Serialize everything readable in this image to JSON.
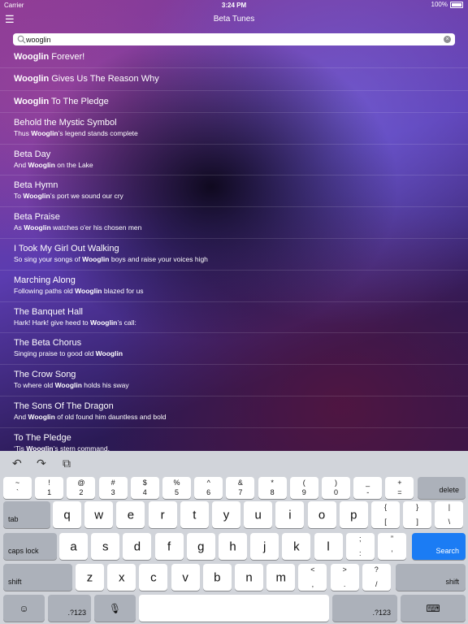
{
  "status": {
    "carrier": "Carrier",
    "time": "3:24 PM",
    "battery": "100%"
  },
  "nav": {
    "title": "Beta Tunes",
    "menu_icon": "hamburger-icon"
  },
  "search": {
    "value": "wooglin"
  },
  "results": [
    {
      "title": [
        {
          "t": "Wooglin",
          "b": true
        },
        {
          "t": " Forever!",
          "b": false
        }
      ],
      "subtitle": []
    },
    {
      "title": [
        {
          "t": "Wooglin",
          "b": true
        },
        {
          "t": " Gives Us The Reason Why",
          "b": false
        }
      ],
      "subtitle": []
    },
    {
      "title": [
        {
          "t": "Wooglin",
          "b": true
        },
        {
          "t": " To The Pledge",
          "b": false
        }
      ],
      "subtitle": []
    },
    {
      "title": [
        {
          "t": "Behold the Mystic Symbol",
          "b": false
        }
      ],
      "subtitle": [
        {
          "t": "Thus ",
          "b": false
        },
        {
          "t": "Wooglin",
          "b": true
        },
        {
          "t": "’s legend stands complete",
          "b": false
        }
      ]
    },
    {
      "title": [
        {
          "t": "Beta Day",
          "b": false
        }
      ],
      "subtitle": [
        {
          "t": "And ",
          "b": false
        },
        {
          "t": "Wooglin",
          "b": true
        },
        {
          "t": " on the Lake",
          "b": false
        }
      ]
    },
    {
      "title": [
        {
          "t": "Beta Hymn",
          "b": false
        }
      ],
      "subtitle": [
        {
          "t": "To ",
          "b": false
        },
        {
          "t": "Wooglin",
          "b": true
        },
        {
          "t": "’s port we sound our cry",
          "b": false
        }
      ]
    },
    {
      "title": [
        {
          "t": "Beta Praise",
          "b": false
        }
      ],
      "subtitle": [
        {
          "t": "As ",
          "b": false
        },
        {
          "t": "Wooglin",
          "b": true
        },
        {
          "t": " watches o'er his chosen men",
          "b": false
        }
      ]
    },
    {
      "title": [
        {
          "t": "I Took My Girl Out Walking",
          "b": false
        }
      ],
      "subtitle": [
        {
          "t": "So sing your songs of ",
          "b": false
        },
        {
          "t": "Wooglin",
          "b": true
        },
        {
          "t": " boys and raise your voices high",
          "b": false
        }
      ]
    },
    {
      "title": [
        {
          "t": "Marching Along",
          "b": false
        }
      ],
      "subtitle": [
        {
          "t": "Following paths old ",
          "b": false
        },
        {
          "t": "Wooglin",
          "b": true
        },
        {
          "t": " blazed for us",
          "b": false
        }
      ]
    },
    {
      "title": [
        {
          "t": "The Banquet Hall",
          "b": false
        }
      ],
      "subtitle": [
        {
          "t": "Hark! Hark! give heed to ",
          "b": false
        },
        {
          "t": "Wooglin",
          "b": true
        },
        {
          "t": "’s call:",
          "b": false
        }
      ]
    },
    {
      "title": [
        {
          "t": "The Beta Chorus",
          "b": false
        }
      ],
      "subtitle": [
        {
          "t": "Singing praise to good old ",
          "b": false
        },
        {
          "t": "Wooglin",
          "b": true
        }
      ]
    },
    {
      "title": [
        {
          "t": "The Crow Song",
          "b": false
        }
      ],
      "subtitle": [
        {
          "t": "To where old ",
          "b": false
        },
        {
          "t": "Wooglin",
          "b": true
        },
        {
          "t": " holds his sway",
          "b": false
        }
      ]
    },
    {
      "title": [
        {
          "t": "The Sons Of The Dragon",
          "b": false
        }
      ],
      "subtitle": [
        {
          "t": "And ",
          "b": false
        },
        {
          "t": "Wooglin",
          "b": true
        },
        {
          "t": " of old found him dauntless and bold",
          "b": false
        }
      ]
    },
    {
      "title": [
        {
          "t": "To The Pledge",
          "b": false
        }
      ],
      "subtitle": [
        {
          "t": "‘Tis ",
          "b": false
        },
        {
          "t": "Wooglin",
          "b": true
        },
        {
          "t": "’s stern command.",
          "b": false
        }
      ]
    }
  ],
  "keyboard": {
    "tools": [
      {
        "name": "undo-icon",
        "glyph": "↶"
      },
      {
        "name": "redo-icon",
        "glyph": "↷"
      },
      {
        "name": "paste-icon",
        "glyph": "⧉"
      }
    ],
    "row1": [
      [
        "~",
        "`"
      ],
      [
        "!",
        "1"
      ],
      [
        "@",
        "2"
      ],
      [
        "#",
        "3"
      ],
      [
        "$",
        "4"
      ],
      [
        "%",
        "5"
      ],
      [
        "^",
        "6"
      ],
      [
        "&",
        "7"
      ],
      [
        "*",
        "8"
      ],
      [
        "(",
        "9"
      ],
      [
        ")",
        "0"
      ],
      [
        "_",
        "-"
      ],
      [
        "+",
        "="
      ]
    ],
    "row2": [
      "q",
      "w",
      "e",
      "r",
      "t",
      "y",
      "u",
      "i",
      "o",
      "p",
      [
        "{",
        "["
      ],
      [
        "}",
        "]"
      ],
      [
        "|",
        "\\"
      ]
    ],
    "row3": [
      "a",
      "s",
      "d",
      "f",
      "g",
      "h",
      "j",
      "k",
      "l",
      [
        ";",
        ":"
      ],
      [
        "”",
        "’"
      ]
    ],
    "row4": [
      "z",
      "x",
      "c",
      "v",
      "b",
      "n",
      "m",
      [
        "<",
        ","
      ],
      [
        ">",
        "."
      ],
      [
        "?",
        "/"
      ]
    ],
    "labels": {
      "delete": "delete",
      "tab": "tab",
      "caps": "caps lock",
      "search": "Search",
      "shift": "shift",
      "num": ".?123"
    }
  }
}
